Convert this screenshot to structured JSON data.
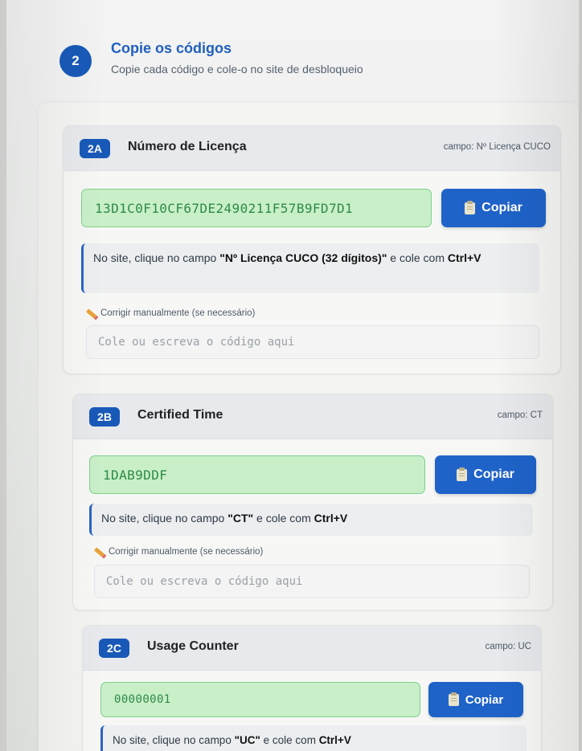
{
  "step": {
    "number": "2",
    "title": "Copie os códigos",
    "subtitle": "Copie cada código e cole-o no site de desbloqueio"
  },
  "copy_label": "Copiar",
  "fix_label": "Corrigir manualmente (se necessário)",
  "fix_placeholder": "Cole ou escreva o código aqui",
  "hint_parts": {
    "prefix": "No site, clique no campo ",
    "mid": " e cole com ",
    "keys": "Ctrl+V"
  },
  "icons": {
    "copy": "clipboard-icon",
    "fix": "pencil-icon"
  },
  "colors": {
    "accent": "#1f63c9",
    "code_bg": "#c9efc9",
    "code_text": "#2c8b45"
  },
  "cards": [
    {
      "tag": "2A",
      "title": "Número de Licença",
      "field": "campo: Nº Licença CUCO",
      "code": "13D1C0F10CF67DE2490211F57B9FD7D1",
      "hint_field": "\"Nº Licença CUCO (32 dígitos)\""
    },
    {
      "tag": "2B",
      "title": "Certified Time",
      "field": "campo: CT",
      "code": "1DAB9DDF",
      "hint_field": "\"CT\""
    },
    {
      "tag": "2C",
      "title": "Usage Counter",
      "field": "campo: UC",
      "code": "00000001",
      "hint_field": "\"UC\""
    }
  ]
}
